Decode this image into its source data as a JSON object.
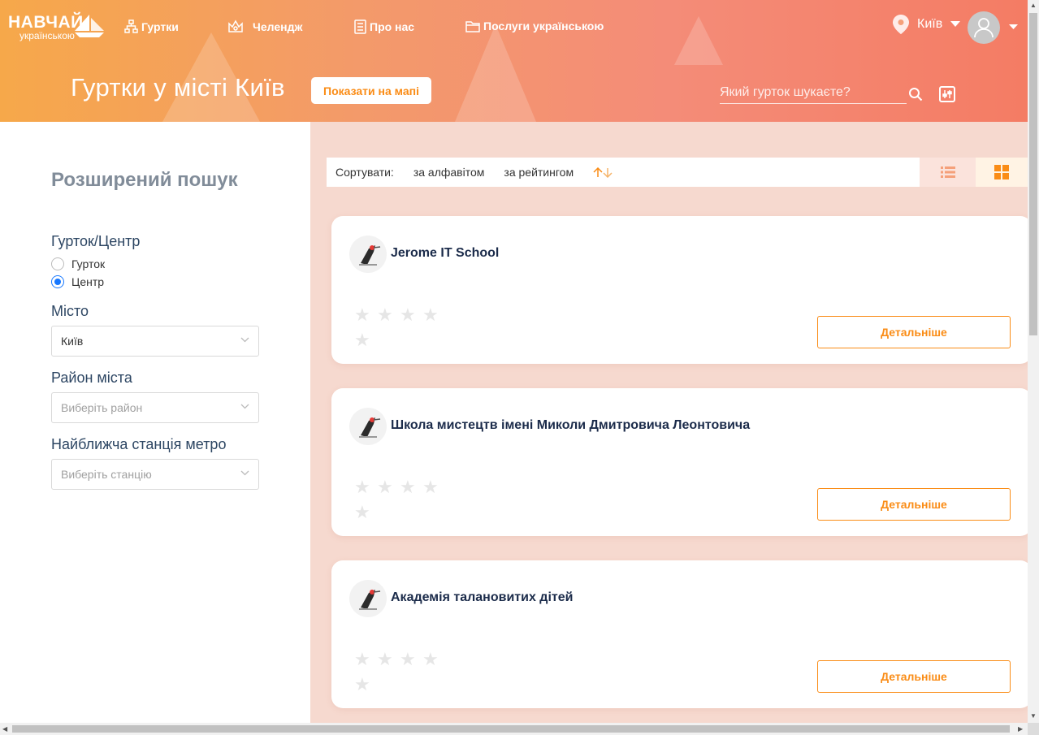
{
  "header": {
    "logo_line1": "НАВЧАЙ",
    "logo_line2": "українською",
    "nav": [
      {
        "label": "Гуртки",
        "icon": "hierarchy-icon"
      },
      {
        "label": "Челендж",
        "icon": "crown-icon"
      },
      {
        "label": "Про нас",
        "icon": "document-icon"
      },
      {
        "label": "Послуги українською",
        "icon": "folder-icon"
      }
    ],
    "city": "Київ",
    "page_title": "Гуртки у місті Київ",
    "map_button": "Показати на мапі",
    "search_placeholder": "Який гурток шукаєте?"
  },
  "sidebar": {
    "title": "Розширений пошук",
    "type_label": "Гурток/Центр",
    "type_options": [
      "Гурток",
      "Центр"
    ],
    "type_selected": "Центр",
    "city_label": "Місто",
    "city_value": "Київ",
    "district_label": "Район міста",
    "district_placeholder": "Виберіть район",
    "metro_label": "Найближча станція метро",
    "metro_placeholder": "Виберіть станцію"
  },
  "sort": {
    "label": "Сортувати:",
    "by_alpha": "за алфавітом",
    "by_rating": "за рейтингом"
  },
  "cards": [
    {
      "title": "Jerome IT School",
      "details": "Детальніше"
    },
    {
      "title": "Школа мистецтв імені Миколи Дмитровича Леонтовича",
      "details": "Детальніше"
    },
    {
      "title": "Академія талановитих дітей",
      "details": "Детальніше"
    }
  ],
  "colors": {
    "accent": "#fa8c16",
    "title_dark": "#1b2b4a",
    "main_bg": "#f6d9cf"
  }
}
